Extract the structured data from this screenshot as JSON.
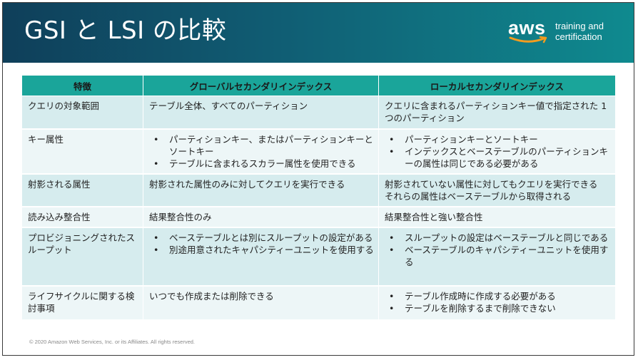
{
  "title": "GSI と LSI の比較",
  "logo": {
    "brand": "aws",
    "line1": "training and",
    "line2": "certification"
  },
  "table": {
    "headers": [
      "特徴",
      "グローバルセカンダリインデックス",
      "ローカルセカンダリインデックス"
    ],
    "rows": [
      {
        "feature": "クエリの対象範囲",
        "gsi": [
          "テーブル全体、すべてのパーティション"
        ],
        "lsi": [
          "クエリに含まれるパーティションキー値で指定された 1 つのパーティション"
        ]
      },
      {
        "feature": "キー属性",
        "gsi": [
          "パーティションキー、またはパーティションキーとソートキー",
          "テーブルに含まれるスカラー属性を使用できる"
        ],
        "lsi": [
          "パーティションキーとソートキー",
          "インデックスとベーステーブルのパーティションキーの属性は同じである必要がある"
        ]
      },
      {
        "feature": "射影される属性",
        "gsi": [
          "射影された属性のみに対してクエリを実行できる"
        ],
        "lsi": [
          "射影されていない属性に対してもクエリを実行できる",
          "それらの属性はベーステーブルから取得される"
        ]
      },
      {
        "feature": "読み込み整合性",
        "gsi": [
          "結果整合性のみ"
        ],
        "lsi": [
          "結果整合性と強い整合性"
        ]
      },
      {
        "feature": "プロビジョニングされたスループット",
        "gsi": [
          "ベーステーブルとは別にスループットの設定がある",
          "別途用意されたキャパシティーユニットを使用する"
        ],
        "lsi": [
          "スループットの設定はベーステーブルと同じである",
          "ベーステーブルのキャパシティーユニットを使用する"
        ]
      },
      {
        "feature": "ライフサイクルに関する検討事項",
        "gsi": [
          "いつでも作成または削除できる"
        ],
        "lsi": [
          "テーブル作成時に作成する必要がある",
          "テーブルを削除するまで削除できない"
        ]
      }
    ]
  },
  "footer": "© 2020 Amazon Web Services, Inc. or its Affiliates. All rights reserved.",
  "colors": {
    "header_start": "#0f3f5a",
    "header_end": "#0f8a8f",
    "table_header": "#1aa59a",
    "row_odd": "#d6ecee",
    "row_even": "#edf6f7",
    "logo_smile": "#f29c1f"
  }
}
